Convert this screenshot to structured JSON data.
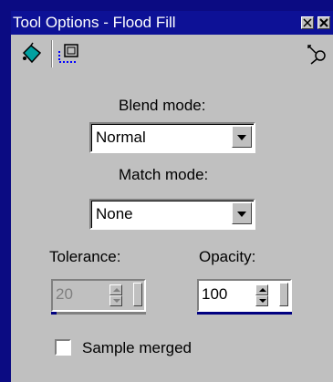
{
  "window": {
    "title": "Tool Options - Flood Fill"
  },
  "tabs": [
    {
      "icon": "paint-bucket-icon"
    },
    {
      "icon": "selection-marquee-icon"
    }
  ],
  "fields": {
    "blend_mode_label": "Blend mode:",
    "blend_mode_value": "Normal",
    "match_mode_label": "Match mode:",
    "match_mode_value": "None",
    "tolerance_label": "Tolerance:",
    "tolerance_value": "20",
    "opacity_label": "Opacity:",
    "opacity_value": "100",
    "sample_merged_label": "Sample merged"
  },
  "state": {
    "tolerance_enabled": false,
    "sample_merged_checked": false
  },
  "colors": {
    "title_bar": "#0d1196",
    "panel": "#c0c0c0",
    "slider_bar": "#000080"
  }
}
